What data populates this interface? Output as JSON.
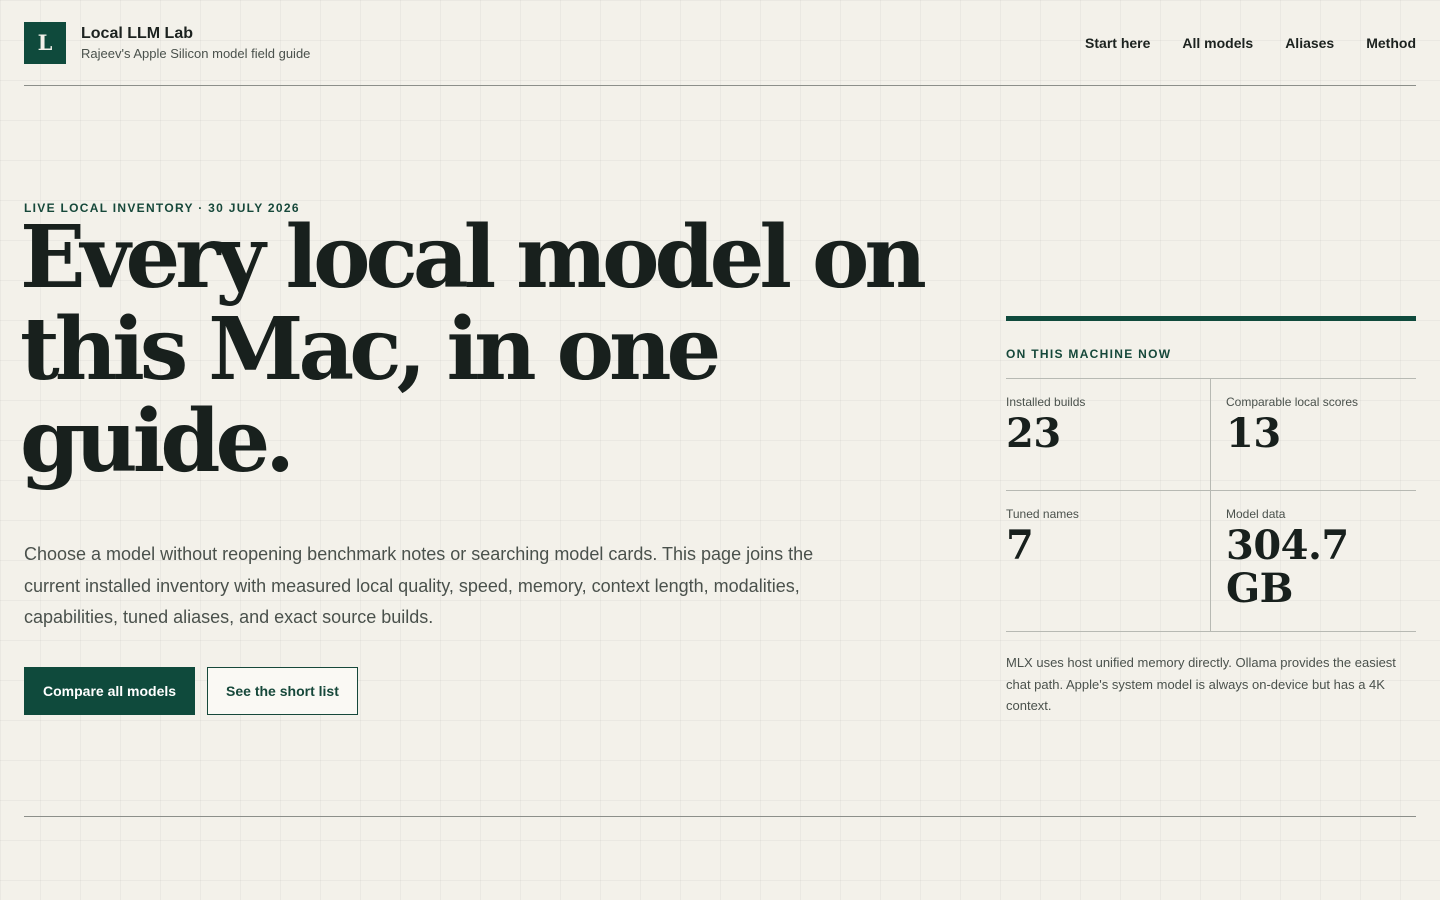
{
  "header": {
    "logo_letter": "L",
    "title": "Local LLM Lab",
    "subtitle": "Rajeev's Apple Silicon model field guide",
    "nav": [
      "Start here",
      "All models",
      "Aliases",
      "Method"
    ]
  },
  "hero": {
    "eyebrow": "LIVE LOCAL INVENTORY · 30 JULY 2026",
    "title": "Every local model on this Mac, in one guide.",
    "lede": "Choose a model without reopening benchmark notes or searching model cards. This page joins the current installed inventory with measured local quality, speed, memory, context length, modalities, capabilities, tuned aliases, and exact source builds.",
    "primary_cta": "Compare all models",
    "secondary_cta": "See the short list"
  },
  "panel": {
    "label": "ON THIS MACHINE NOW",
    "stats": [
      {
        "label": "Installed builds",
        "value": "23"
      },
      {
        "label": "Comparable local scores",
        "value": "13"
      },
      {
        "label": "Tuned names",
        "value": "7"
      },
      {
        "label": "Model data",
        "value": "304.7 GB"
      }
    ],
    "note": "MLX uses host unified memory directly. Ollama provides the easiest chat path. Apple's system model is always on-device but has a 4K context."
  },
  "colors": {
    "background": "#f3f1ea",
    "accent": "#0f4a3c",
    "text": "#18201d",
    "muted": "#4a514c"
  }
}
